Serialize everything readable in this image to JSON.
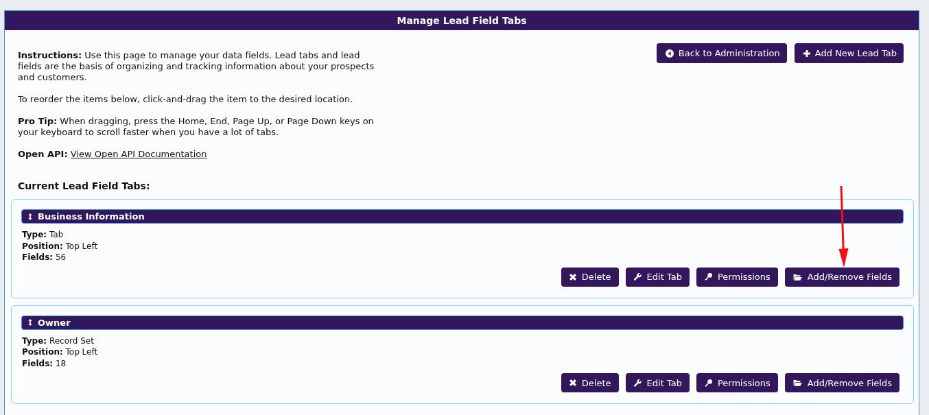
{
  "window": {
    "title": "Manage Lead Field Tabs"
  },
  "header_buttons": [
    {
      "kind": "back",
      "label": "Back to Administration"
    },
    {
      "kind": "add",
      "label": "Add New Lead Tab"
    }
  ],
  "intro": [
    {
      "text": "**Instructions:** Use this page to manage your data fields. Lead tabs and lead fields are the basis of organizing and tracking information about your prospects and customers."
    },
    {
      "text": "To reorder the items below, click-and-drag the item to the desired location."
    },
    {
      "text": "**Pro Tip:** When dragging, press the Home, End, Page Up, or Page Down keys on your keyboard to scroll faster when you have a lot of tabs."
    },
    {
      "text": "**Open API:**",
      "link": "View Open API Documentation"
    }
  ],
  "section_title": "Current Lead Field Tabs:",
  "tabs": [
    {
      "name": "Business Information",
      "details": [
        "**Type:** Tab",
        "**Position:** Top Left",
        "**Fields:** 56"
      ],
      "buttons": [
        {
          "kind": "delete",
          "label": "Delete",
          "annotated": false
        },
        {
          "kind": "edit",
          "label": "Edit Tab",
          "annotated": false
        },
        {
          "kind": "permissions",
          "label": "Permissions",
          "annotated": false
        },
        {
          "kind": "fields",
          "label": "Add/Remove Fields",
          "annotated": true
        }
      ]
    },
    {
      "name": "Owner",
      "details": [
        "**Type:** Record Set",
        "**Position:** Top Left",
        "**Fields:** 18"
      ],
      "buttons": [
        {
          "kind": "delete",
          "label": "Delete",
          "annotated": false
        },
        {
          "kind": "edit",
          "label": "Edit Tab",
          "annotated": false
        },
        {
          "kind": "permissions",
          "label": "Permissions",
          "annotated": false
        },
        {
          "kind": "fields",
          "label": "Add/Remove Fields",
          "annotated": false
        }
      ]
    }
  ]
}
